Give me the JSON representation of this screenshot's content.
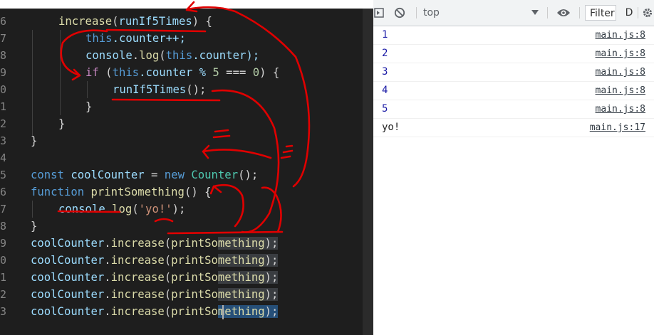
{
  "editor": {
    "line_numbers": [
      "6",
      "7",
      "8",
      "9",
      "0",
      "1",
      "2",
      "3",
      "4",
      "5",
      "6",
      "7",
      "8",
      "9",
      "0",
      "1",
      "2",
      "3"
    ],
    "code": {
      "l1": {
        "a": "increase",
        "b": "(",
        "c": "runIf5Times",
        "d": ") {"
      },
      "l2": {
        "a": "this",
        "b": ".counter++;"
      },
      "l3": {
        "a": "console",
        "b": ".",
        "c": "log",
        "d": "(",
        "e": "this",
        "f": ".counter);"
      },
      "l4": {
        "a": "if",
        "b": " (",
        "c": "this",
        "d": ".counter % ",
        "e": "5",
        "f": " === ",
        "g": "0",
        "h": ") {"
      },
      "l5": {
        "a": "runIf5Times",
        "b": "();"
      },
      "l6": {
        "a": "}"
      },
      "l7": {
        "a": "}"
      },
      "l8": {
        "a": "}"
      },
      "l9": {
        "a": ""
      },
      "l10": {
        "a": "const",
        "b": " ",
        "c": "coolCounter",
        "d": " = ",
        "e": "new",
        "f": " ",
        "g": "Counter",
        "h": "();"
      },
      "l11": {
        "a": "function",
        "b": " ",
        "c": "printSomething",
        "d": "() {"
      },
      "l12": {
        "a": "console",
        "b": ".",
        "c": "log",
        "d": "(",
        "e": "'yo!'",
        "f": ");"
      },
      "l13": {
        "a": "}"
      },
      "l14": {
        "a": "coolCounter",
        "b": ".",
        "c": "increase",
        "d": "(",
        "e": "printSo",
        "f": "mething",
        "g": ");"
      },
      "l15": {
        "a": "coolCounter",
        "b": ".",
        "c": "increase",
        "d": "(",
        "e": "printSo",
        "f": "mething",
        "g": ");"
      },
      "l16": {
        "a": "coolCounter",
        "b": ".",
        "c": "increase",
        "d": "(",
        "e": "printSo",
        "f": "mething",
        "g": ");"
      },
      "l17": {
        "a": "coolCounter",
        "b": ".",
        "c": "increase",
        "d": "(",
        "e": "printSo",
        "f": "mething",
        "g": ");"
      },
      "l18": {
        "a": "coolCounter",
        "b": ".",
        "c": "increase",
        "d": "(",
        "e": "printSo",
        "f": "mething",
        "g": ");"
      }
    }
  },
  "devtools": {
    "context_label": "top",
    "filter_label": "Filter",
    "levels_label": "D",
    "icons": [
      "sidebar-icon",
      "clear-console-icon",
      "dropdown-icon",
      "eye-icon",
      "gear-icon"
    ],
    "logs": [
      {
        "value": "1",
        "source": "main.js:8"
      },
      {
        "value": "2",
        "source": "main.js:8"
      },
      {
        "value": "3",
        "source": "main.js:8"
      },
      {
        "value": "4",
        "source": "main.js:8"
      },
      {
        "value": "5",
        "source": "main.js:8"
      },
      {
        "value": "yo!",
        "source": "main.js:17"
      }
    ]
  },
  "colors": {
    "editor_bg": "#1e1e1e",
    "keyword": "#569cd6",
    "function": "#dcdcaa",
    "class": "#4ec9b0",
    "variable": "#9cdcfe",
    "string": "#ce9178",
    "number": "#b5cea8",
    "annotation": "#e00000",
    "console_number": "#1a1aa6"
  }
}
